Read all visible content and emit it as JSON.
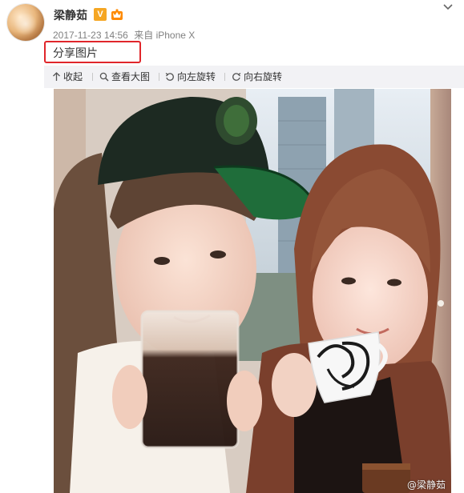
{
  "post": {
    "user_name": "梁静茹",
    "verified_badge": "V",
    "timestamp": "2017-11-23 14:56",
    "via_label": "来自",
    "device": "iPhone X",
    "text": "分享图片"
  },
  "toolbar": {
    "items": [
      {
        "icon": "collapse-arrow-icon",
        "label": "收起"
      },
      {
        "icon": "magnifier-icon",
        "label": "查看大图"
      },
      {
        "icon": "rotate-left-icon",
        "label": "向左旋转"
      },
      {
        "icon": "rotate-right-icon",
        "label": "向右旋转"
      }
    ]
  },
  "image": {
    "watermark": "@梁静茹"
  },
  "colors": {
    "highlight": "#e0262b",
    "verified": "#f5a623",
    "toolbar_bg": "#f2f2f5",
    "meta_text": "#808080"
  }
}
